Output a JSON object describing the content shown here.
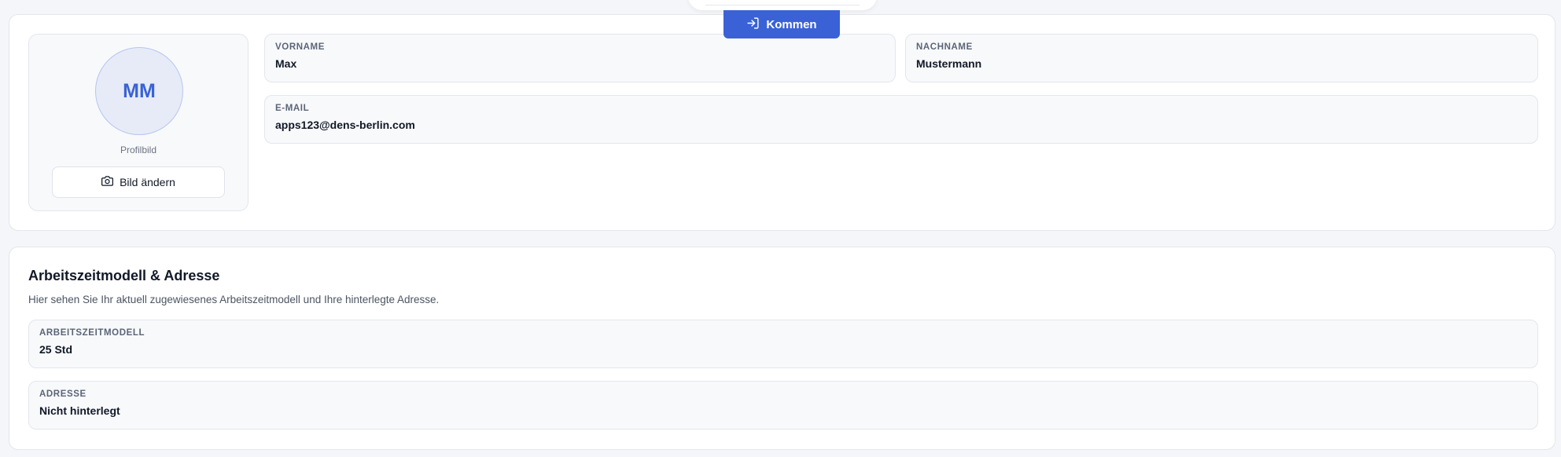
{
  "header": {
    "kommen_label": "Kommen",
    "kommen_icon": "log-in-icon",
    "accent_color": "#3a62d6"
  },
  "profile": {
    "initials": "MM",
    "avatar_caption": "Profilbild",
    "change_image_label": "Bild ändern",
    "change_image_icon": "camera-icon",
    "fields": {
      "vorname": {
        "label": "VORNAME",
        "value": "Max"
      },
      "nachname": {
        "label": "NACHNAME",
        "value": "Mustermann"
      },
      "email": {
        "label": "E-MAIL",
        "value": "apps123@dens-berlin.com"
      }
    }
  },
  "work": {
    "title": "Arbeitszeitmodell & Adresse",
    "description": "Hier sehen Sie Ihr aktuell zugewiesenes Arbeitszeitmodell und Ihre hinterlegte Adresse.",
    "fields": {
      "modell": {
        "label": "ARBEITSZEITMODELL",
        "value": "25 Std"
      },
      "adresse": {
        "label": "ADRESSE",
        "value": "Nicht hinterlegt"
      }
    }
  }
}
